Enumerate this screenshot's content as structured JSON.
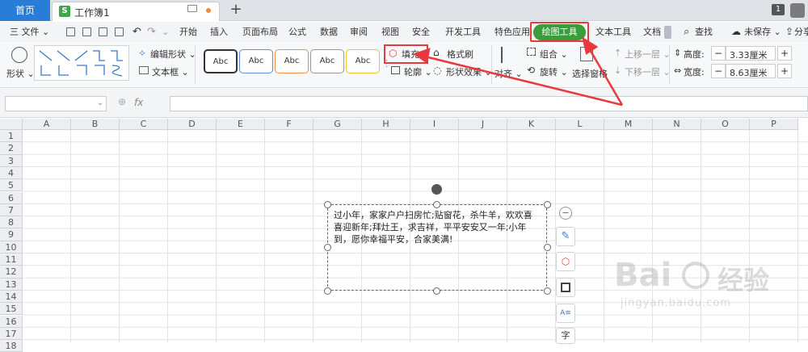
{
  "tabs": {
    "home": "首页",
    "doc": "工作簿1",
    "doc_badge": "S",
    "new_tab": "+",
    "page_num": "1"
  },
  "menu": {
    "file": "三 文件 ⌄",
    "items": [
      "开始",
      "插入",
      "页面布局",
      "公式",
      "数据",
      "审阅",
      "视图",
      "安全",
      "开发工具",
      "特色应用",
      "绘图工具",
      "文本工具",
      "文档"
    ],
    "search": "查找",
    "unsaved": "未保存 ⌄",
    "share": "分享"
  },
  "ribbon": {
    "shape": "形状 ⌄",
    "edit_shape": "编辑形状 ⌄",
    "textbox": "文本框 ⌄",
    "styles": [
      "Abc",
      "Abc",
      "Abc",
      "Abc",
      "Abc"
    ],
    "style_colors": [
      "#333333",
      "#5b8fd6",
      "#e8904a",
      "#999999",
      "#f0c030"
    ],
    "fill": "填充 ⌄",
    "outline": "轮廓 ⌄",
    "format_painter": "格式刷",
    "shape_effect": "形状效果 ⌄",
    "align": "对齐 ⌄",
    "group": "组合 ⌄",
    "rotate": "旋转 ⌄",
    "select_pane": "选择窗格",
    "move_up": "上移一层 ⌄",
    "move_down": "下移一层 ⌄",
    "height_label": "高度:",
    "height_value": "3.33厘米",
    "width_label": "宽度:",
    "width_value": "8.63厘米"
  },
  "formula": {
    "fx": "fx"
  },
  "grid": {
    "columns": [
      "A",
      "B",
      "C",
      "D",
      "E",
      "F",
      "G",
      "H",
      "I",
      "J",
      "K",
      "L",
      "M",
      "N",
      "O",
      "P"
    ],
    "rows": [
      "1",
      "2",
      "3",
      "4",
      "5",
      "6",
      "7",
      "8",
      "9",
      "10",
      "11",
      "12",
      "13",
      "14",
      "15",
      "16",
      "17",
      "18"
    ]
  },
  "textbox": {
    "content": "过小年，家家户户扫房忙;贴窗花，杀牛羊，欢欢喜喜迎新年;拜灶王，求吉祥，平平安安又一年;小年到，愿你幸福平安，合家美满!"
  },
  "watermark": {
    "brand": "Bai",
    "brand2": "经验",
    "url": "jingyan.baidu.com"
  }
}
